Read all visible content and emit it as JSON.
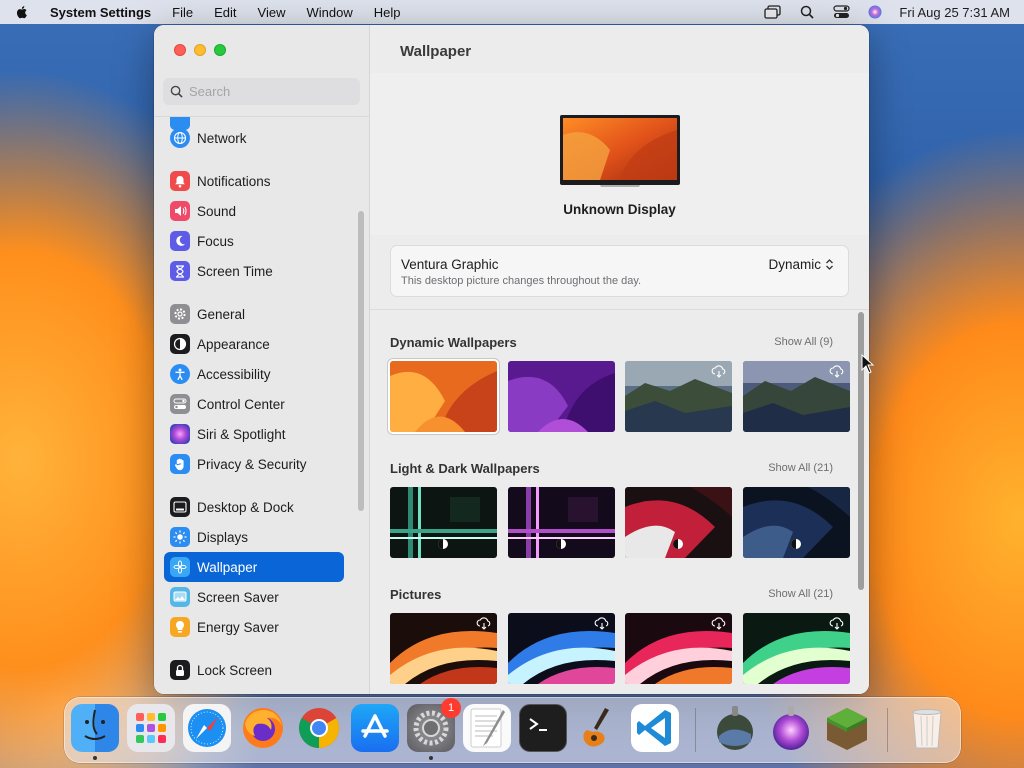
{
  "menubar": {
    "app_name": "System Settings",
    "items": [
      "File",
      "Edit",
      "View",
      "Window",
      "Help"
    ],
    "clock": "Fri Aug 25  7:31 AM"
  },
  "window": {
    "search_placeholder": "Search",
    "sidebar": {
      "items": [
        {
          "label": "Network",
          "icon": "network-icon"
        },
        {
          "label": "Notifications",
          "icon": "bell-icon"
        },
        {
          "label": "Sound",
          "icon": "speaker-icon"
        },
        {
          "label": "Focus",
          "icon": "moon-icon"
        },
        {
          "label": "Screen Time",
          "icon": "hourglass-icon"
        },
        {
          "label": "General",
          "icon": "gear-icon"
        },
        {
          "label": "Appearance",
          "icon": "appearance-icon"
        },
        {
          "label": "Accessibility",
          "icon": "accessibility-icon"
        },
        {
          "label": "Control Center",
          "icon": "control-center-icon"
        },
        {
          "label": "Siri & Spotlight",
          "icon": "siri-icon"
        },
        {
          "label": "Privacy & Security",
          "icon": "hand-icon"
        },
        {
          "label": "Desktop & Dock",
          "icon": "dock-icon"
        },
        {
          "label": "Displays",
          "icon": "sun-icon"
        },
        {
          "label": "Wallpaper",
          "icon": "flower-icon"
        },
        {
          "label": "Screen Saver",
          "icon": "screensaver-icon"
        },
        {
          "label": "Energy Saver",
          "icon": "bulb-icon"
        },
        {
          "label": "Lock Screen",
          "icon": "lock-icon"
        }
      ],
      "selected": "Wallpaper"
    },
    "main": {
      "title": "Wallpaper",
      "display_name": "Unknown Display",
      "current_wallpaper": {
        "name": "Ventura Graphic",
        "description": "This desktop picture changes throughout the day.",
        "mode": "Dynamic"
      },
      "galleries": [
        {
          "title": "Dynamic Wallpapers",
          "show_all": "Show All (9)"
        },
        {
          "title": "Light & Dark Wallpapers",
          "show_all": "Show All (21)"
        },
        {
          "title": "Pictures",
          "show_all": "Show All (21)"
        }
      ]
    }
  },
  "dock": {
    "apps": [
      "Finder",
      "Launchpad",
      "Safari",
      "Firefox",
      "Chrome",
      "App Store",
      "System Settings",
      "TextEdit",
      "Terminal",
      "GarageBand",
      "Visual Studio Code",
      "Downloads",
      "Siri",
      "Minecraft",
      "Trash"
    ],
    "settings_badge": "1"
  },
  "colors": {
    "accent": "#0a65d6",
    "badge": "#ff3b30"
  }
}
